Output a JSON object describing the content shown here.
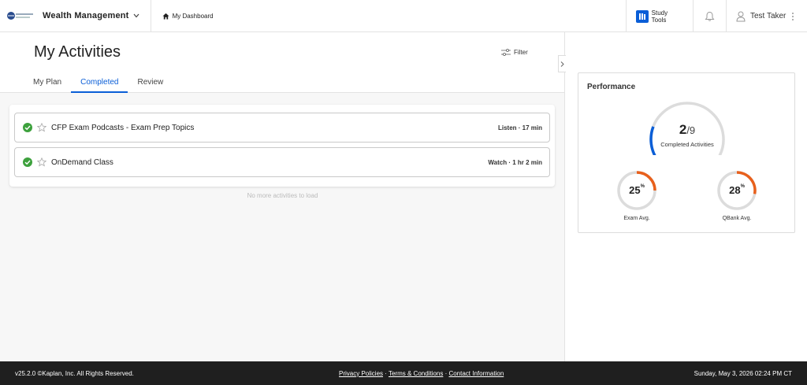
{
  "header": {
    "brand": "Wealth Management",
    "dashboard_link": "My Dashboard",
    "study_tools": "Study Tools",
    "user_name": "Test Taker"
  },
  "main": {
    "title": "My Activities",
    "filter_label": "Filter",
    "tabs": [
      {
        "label": "My Plan",
        "active": false
      },
      {
        "label": "Completed",
        "active": true
      },
      {
        "label": "Review",
        "active": false
      }
    ],
    "activities": [
      {
        "title": "CFP Exam Podcasts - Exam Prep Topics",
        "meta": "Listen · 17 min",
        "completed": true,
        "starred": false
      },
      {
        "title": "OnDemand Class",
        "meta": "Watch · 1 hr 2 min",
        "completed": true,
        "starred": false
      }
    ],
    "no_more": "No more activities to load"
  },
  "performance": {
    "title": "Performance",
    "completed_count": "2",
    "total_count": "/9",
    "completed_caption": "Completed Activities",
    "completed_fraction": 0.222,
    "exam_avg": {
      "value": "25",
      "unit": "%",
      "caption": "Exam Avg.",
      "fraction": 0.25
    },
    "qbank_avg": {
      "value": "28",
      "unit": "%",
      "caption": "QBank Avg.",
      "fraction": 0.28
    }
  },
  "colors": {
    "accent": "#0a5ed7",
    "gauge_orange": "#e8601c",
    "check_green": "#3da13d",
    "gauge_track": "#dcdcdc"
  },
  "footer": {
    "copyright": "v25.2.0 ©Kaplan, Inc. All Rights Reserved.",
    "links": [
      "Privacy Policies",
      "Terms & Conditions",
      "Contact Information"
    ],
    "separator": " · ",
    "datetime": "Sunday, May 3, 2026 02:24 PM CT"
  }
}
